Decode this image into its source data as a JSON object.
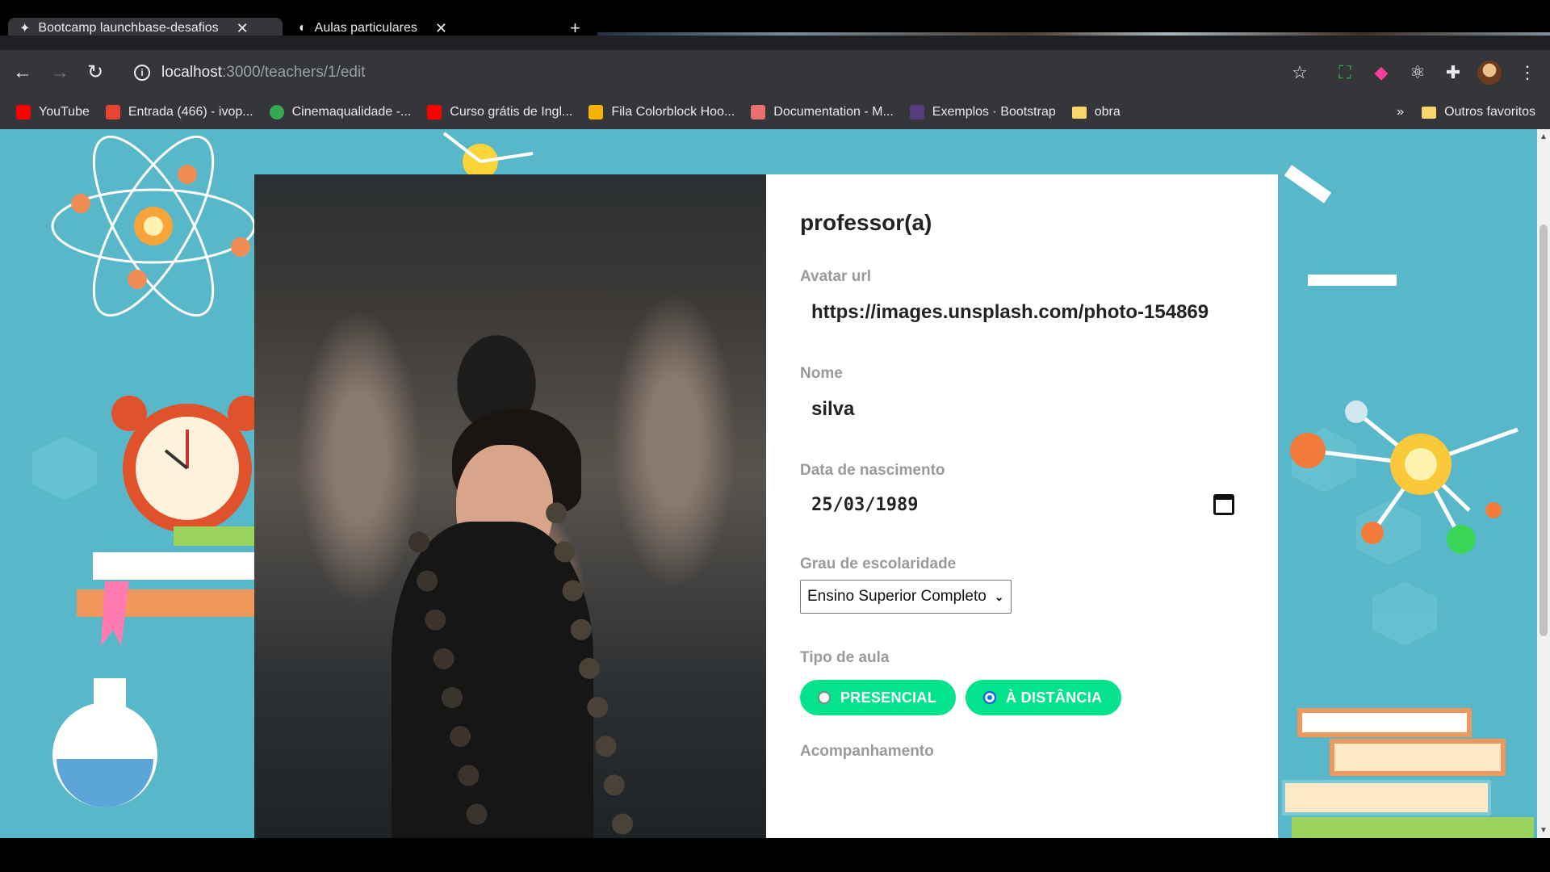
{
  "tabs": [
    {
      "title": "Bootcamp launchbase-desafios",
      "active": true
    },
    {
      "title": "Aulas particulares",
      "active": false
    }
  ],
  "toolbar": {
    "url_host": "localhost",
    "url_path": ":3000/teachers/1/edit",
    "back_icon": "arrow-left-icon",
    "forward_icon": "arrow-right-icon",
    "reload_icon": "reload-icon"
  },
  "bookmarks": [
    {
      "label": "YouTube",
      "color": "#ff0000"
    },
    {
      "label": "Entrada (466) - ivop...",
      "color": "#ea4335"
    },
    {
      "label": "Cinemaqualidade -...",
      "color": "#34a853"
    },
    {
      "label": "Curso grátis de Ingl...",
      "color": "#ff0000"
    },
    {
      "label": "Fila Colorblock Hoo...",
      "color": "#f4b400"
    },
    {
      "label": "Documentation - M...",
      "color": "#e8716d"
    },
    {
      "label": "Exemplos · Bootstrap",
      "color": "#563d7c"
    },
    {
      "label": "obra",
      "color": "#f9d66b"
    }
  ],
  "bookmarks_overflow": "»",
  "other_bookmarks": "Outros favoritos",
  "form": {
    "title": "professor(a)",
    "avatar_label": "Avatar url",
    "avatar_value": "https://images.unsplash.com/photo-154869",
    "name_label": "Nome",
    "name_value": "silva",
    "birth_label": "Data de nascimento",
    "birth_value": "25/03/1989",
    "education_label": "Grau de escolaridade",
    "education_value": "Ensino Superior Completo",
    "class_type_label": "Tipo de aula",
    "class_type_options": [
      {
        "label": "PRESENCIAL",
        "selected": false
      },
      {
        "label": "À DISTÂNCIA",
        "selected": true
      }
    ],
    "next_label": "Acompanhamento"
  },
  "colors": {
    "page_bg": "#58b7c8",
    "pill_bg": "#02e38c",
    "chrome_bg": "#35363a"
  }
}
